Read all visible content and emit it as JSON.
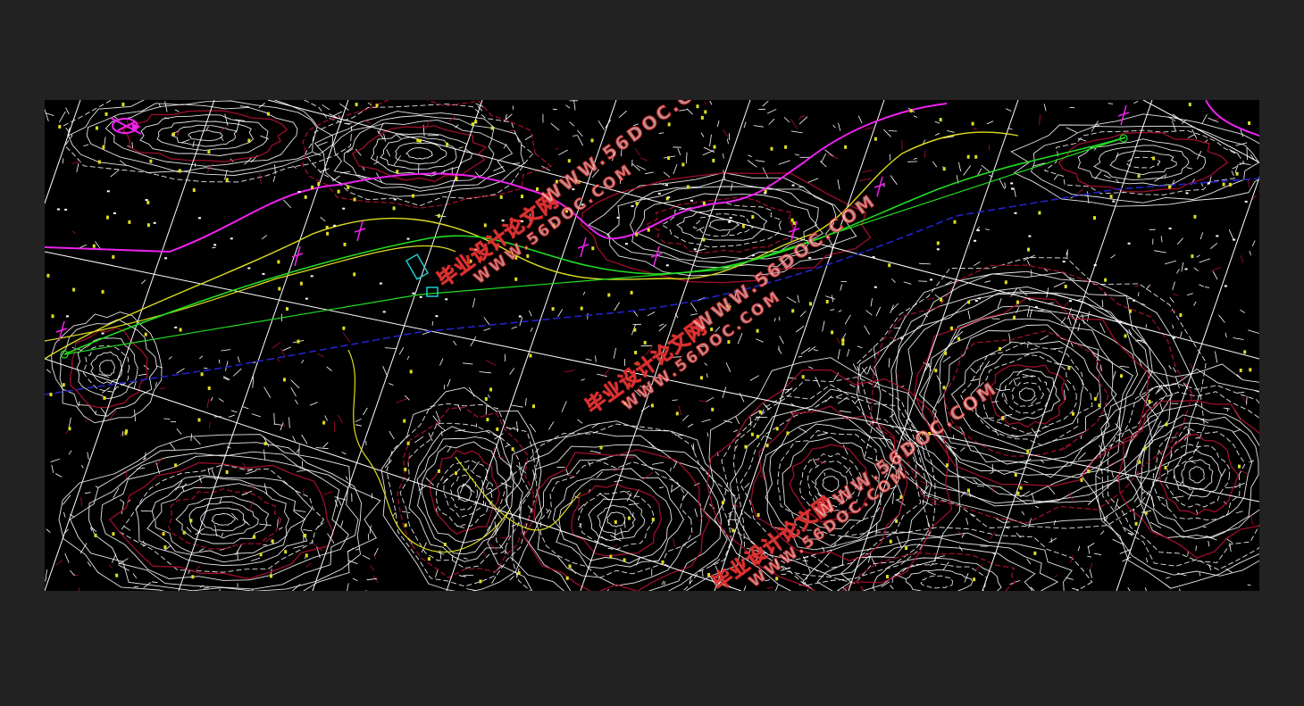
{
  "colors": {
    "frame_background": "#222222",
    "drawing_background": "#000000",
    "contour": "#ffffff",
    "contour_index": "#b01030",
    "route_green": "#22dd22",
    "road_yellow": "#dddd22",
    "river_magenta": "#ee22ee",
    "boundary_blue": "#2222cc",
    "grid_white": "#ffffff",
    "structure_cyan": "#22cccc",
    "watermark_red": "#dd2222"
  },
  "watermarks": [
    {
      "cn": "毕业设计论文网",
      "url": "WWW.56DOC.COM"
    },
    {
      "url": "WWW.56DOC.COM"
    },
    {
      "cn": "毕业设计论文网",
      "url": "WWW.56DOC.COM"
    },
    {
      "url": "WWW.56DOC.COM"
    },
    {
      "cn": "毕业设计论文网",
      "url": "WWW.56DOC.COM"
    },
    {
      "url": "WWW.56DOC.COM"
    }
  ],
  "icons": {
    "north_arrow": "north-arrow-icon"
  }
}
